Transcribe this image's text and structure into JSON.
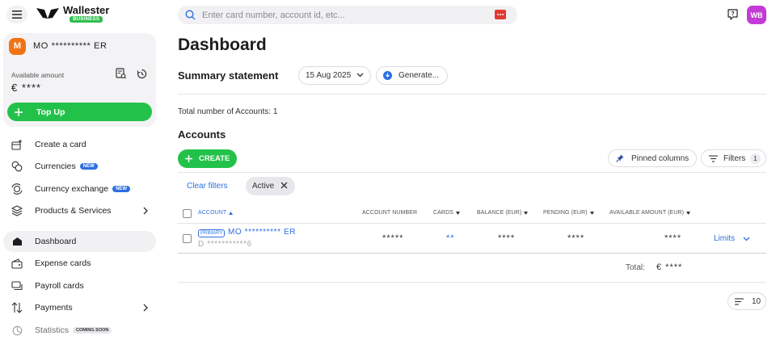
{
  "app": {
    "logo_name": "Wallester",
    "logo_badge": "BUSINESS",
    "user_initials": "WB"
  },
  "search": {
    "placeholder": "Enter card number, account id, etc..."
  },
  "account_card": {
    "avatar": "M",
    "name": "MO **********  ER",
    "available_label": "Available amount",
    "available_value": "€ ****",
    "topup_label": "Top Up"
  },
  "sidebar": {
    "items": [
      {
        "label": "Create a card",
        "icon": "card-add-icon"
      },
      {
        "label": "Currencies",
        "icon": "coins-icon",
        "badge": "NEW"
      },
      {
        "label": "Currency exchange",
        "icon": "exchange-icon",
        "badge": "NEW"
      },
      {
        "label": "Products & Services",
        "icon": "stack-icon"
      },
      {
        "label": "Dashboard",
        "icon": "home-icon"
      },
      {
        "label": "Expense cards",
        "icon": "wallet-icon"
      },
      {
        "label": "Payroll cards",
        "icon": "cards-icon"
      },
      {
        "label": "Payments",
        "icon": "arrows-updown-icon"
      },
      {
        "label": "Statistics",
        "icon": "pie-icon",
        "badge": "COMING SOON"
      }
    ]
  },
  "main": {
    "title": "Dashboard",
    "summary_title": "Summary statement",
    "date": "15 Aug 2025",
    "generate_label": "Generate...",
    "total_accounts": "Total number of Accounts: 1",
    "accounts_title": "Accounts",
    "create_label": "CREATE",
    "pinned_label": "Pinned columns",
    "filters_label": "Filters",
    "filters_count": "1",
    "clear_filters": "Clear filters",
    "active_chip": "Active"
  },
  "table": {
    "headers": {
      "account": "ACCOUNT",
      "account_number": "ACCOUNT NUMBER",
      "cards": "CARDS",
      "balance": "BALANCE (EUR)",
      "pending": "PENDING (EUR)",
      "available": "AVAILABLE AMOUNT (EUR)"
    },
    "rows": [
      {
        "tag": "PRIMARY",
        "name": "MO **********  ER",
        "iban": "D ***********6",
        "account_number": "*****",
        "cards": "**",
        "balance": "****",
        "pending": "****",
        "available": "****",
        "limits": "Limits"
      }
    ],
    "total_label": "Total:",
    "total_value": "€ ****",
    "page_size": "10"
  },
  "colors": {
    "accent_green": "#22c24a",
    "accent_blue": "#2d6fe0",
    "avatar_orange": "#f07415",
    "avatar_purple": "#c33bd6",
    "scan_red": "#e03a33"
  }
}
